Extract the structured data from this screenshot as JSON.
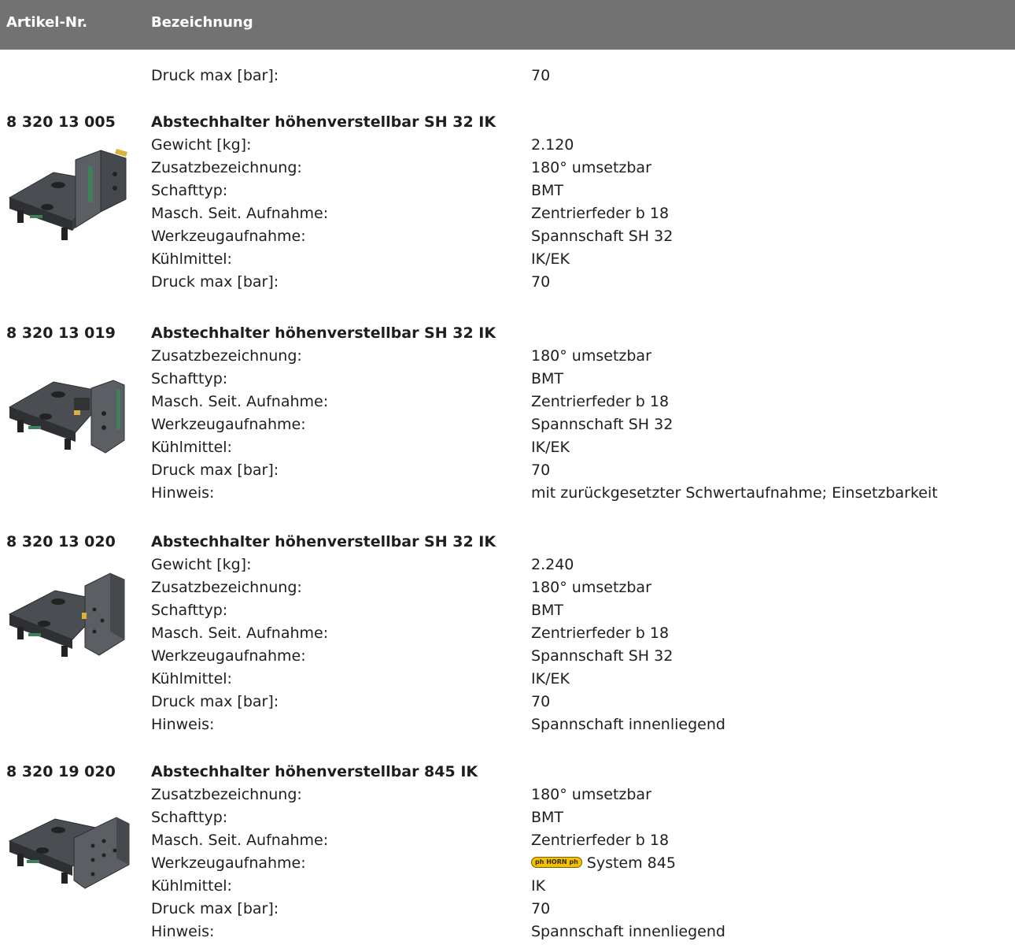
{
  "header": {
    "col_article_no": "Artikel-Nr.",
    "col_description": "Bezeichnung"
  },
  "top_row": {
    "label": "Druck max [bar]:",
    "value": "70"
  },
  "articles": [
    {
      "number": "8 320 13 005",
      "name": "Abstechhalter höhenverstellbar SH 32 IK",
      "props": [
        {
          "label": "Gewicht [kg]:",
          "value": "2.120"
        },
        {
          "label": "Zusatzbezeichnung:",
          "value": "180° umsetzbar"
        },
        {
          "label": "Schafttyp:",
          "value": "BMT"
        },
        {
          "label": "Masch. Seit. Aufnahme:",
          "value": "Zentrierfeder b 18"
        },
        {
          "label": "Werkzeugaufnahme:",
          "value": "Spannschaft SH 32"
        },
        {
          "label": "Kühlmittel:",
          "value": "IK/EK"
        },
        {
          "label": "Druck max [bar]:",
          "value": "70"
        }
      ]
    },
    {
      "number": "8 320 13 019",
      "name": "Abstechhalter höhenverstellbar SH 32 IK",
      "props": [
        {
          "label": "Zusatzbezeichnung:",
          "value": "180° umsetzbar"
        },
        {
          "label": "Schafttyp:",
          "value": "BMT"
        },
        {
          "label": "Masch. Seit. Aufnahme:",
          "value": "Zentrierfeder b 18"
        },
        {
          "label": "Werkzeugaufnahme:",
          "value": "Spannschaft SH 32"
        },
        {
          "label": "Kühlmittel:",
          "value": "IK/EK"
        },
        {
          "label": "Druck max [bar]:",
          "value": "70"
        },
        {
          "label": "Hinweis:",
          "value": "mit zurückgesetzter Schwertaufnahme; Einsetzbarkeit"
        }
      ]
    },
    {
      "number": "8 320 13 020",
      "name": "Abstechhalter höhenverstellbar SH 32 IK",
      "props": [
        {
          "label": "Gewicht [kg]:",
          "value": "2.240"
        },
        {
          "label": "Zusatzbezeichnung:",
          "value": "180° umsetzbar"
        },
        {
          "label": "Schafttyp:",
          "value": "BMT"
        },
        {
          "label": "Masch. Seit. Aufnahme:",
          "value": "Zentrierfeder b 18"
        },
        {
          "label": "Werkzeugaufnahme:",
          "value": "Spannschaft SH 32"
        },
        {
          "label": "Kühlmittel:",
          "value": "IK/EK"
        },
        {
          "label": "Druck max [bar]:",
          "value": "70"
        },
        {
          "label": "Hinweis:",
          "value": "Spannschaft innenliegend"
        }
      ]
    },
    {
      "number": "8 320 19 020",
      "name": "Abstechhalter höhenverstellbar 845   IK",
      "props": [
        {
          "label": "Zusatzbezeichnung:",
          "value": "180° umsetzbar"
        },
        {
          "label": "Schafttyp:",
          "value": "BMT"
        },
        {
          "label": "Masch. Seit. Aufnahme:",
          "value": "Zentrierfeder b 18"
        },
        {
          "label": "Werkzeugaufnahme:",
          "value": "System 845",
          "logo": "ph HORN ph"
        },
        {
          "label": "Kühlmittel:",
          "value": "IK"
        },
        {
          "label": "Druck max [bar]:",
          "value": "70"
        },
        {
          "label": "Hinweis:",
          "value": "Spannschaft innenliegend"
        }
      ]
    }
  ]
}
